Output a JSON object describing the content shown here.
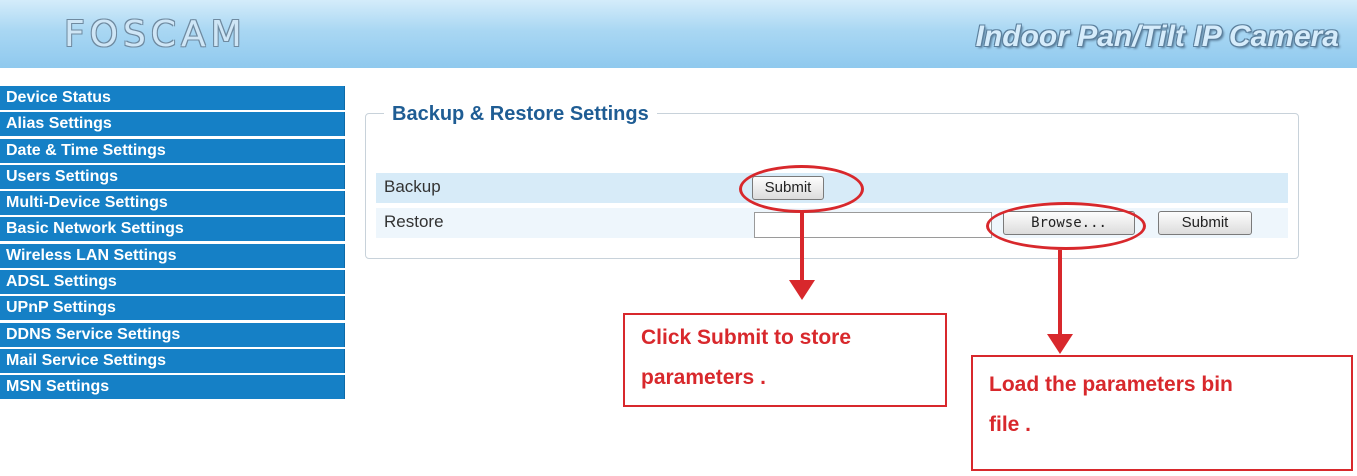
{
  "header": {
    "logo": "FOSCAM",
    "subtitle": "Indoor Pan/Tilt IP Camera",
    "gradient_top": "#d4ecfa",
    "gradient_bottom": "#8fc9ee"
  },
  "sidebar": {
    "color": "#1580c6",
    "items": [
      {
        "label": "Device Status"
      },
      {
        "label": "Alias Settings"
      },
      {
        "label": "Date & Time Settings"
      },
      {
        "label": "Users Settings"
      },
      {
        "label": "Multi-Device Settings"
      },
      {
        "label": "Basic Network Settings"
      },
      {
        "label": "Wireless LAN Settings"
      },
      {
        "label": "ADSL Settings"
      },
      {
        "label": "UPnP Settings"
      },
      {
        "label": "DDNS Service Settings"
      },
      {
        "label": "Mail Service Settings"
      },
      {
        "label": "MSN Settings"
      }
    ]
  },
  "panel": {
    "title": "Backup & Restore Settings",
    "backup": {
      "label": "Backup",
      "submit_label": "Submit"
    },
    "restore": {
      "label": "Restore",
      "file_value": "",
      "browse_label": "Browse...",
      "submit_label": "Submit"
    }
  },
  "annotations": {
    "color": "#d8282c",
    "callout_backup": {
      "line1": "Click  Submit  to  store",
      "line2": "parameters  ."
    },
    "callout_restore": {
      "line1": "Load  the  parameters  bin",
      "line2": "file  ."
    }
  }
}
